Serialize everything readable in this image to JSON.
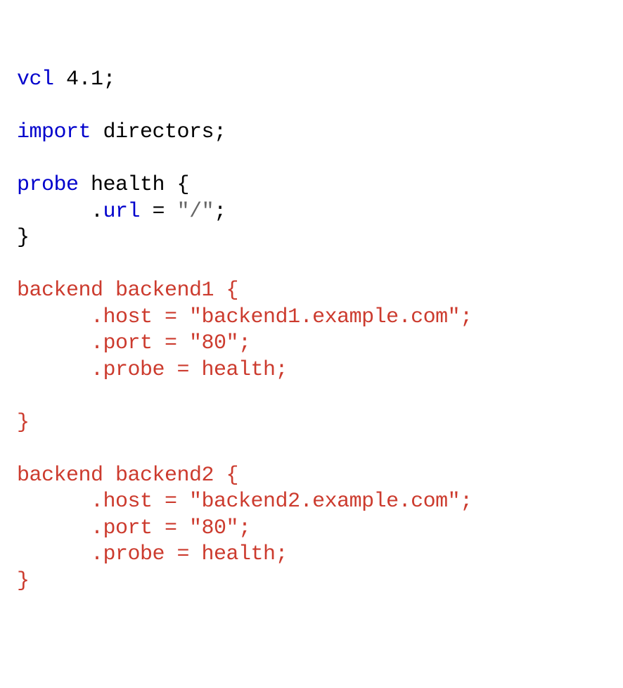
{
  "code": {
    "vcl_kw": "vcl",
    "vcl_ver": " 4.1;",
    "import_kw": "import",
    "import_rest": " directors;",
    "probe_kw": "probe",
    "probe_name": " health {",
    "probe_url_lead": "      .",
    "probe_url_key": "url",
    "probe_url_eq": " = ",
    "probe_url_val": "\"/\"",
    "probe_url_semi": ";",
    "probe_close": "}",
    "b1_decl": "backend backend1 {",
    "b1_host": "      .host = \"backend1.example.com\";",
    "b1_port": "      .port = \"80\";",
    "b1_probe": "      .probe = health;",
    "b1_close": "}",
    "b2_decl": "backend backend2 {",
    "b2_host": "      .host = \"backend2.example.com\";",
    "b2_port": "      .port = \"80\";",
    "b2_probe": "      .probe = health;",
    "b2_close": "}"
  }
}
